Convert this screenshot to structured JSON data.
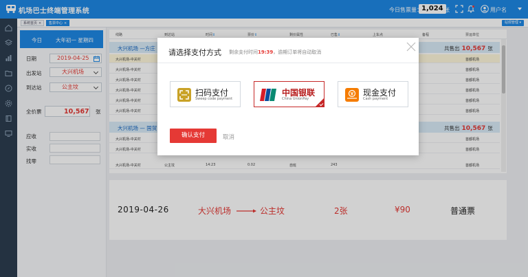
{
  "header": {
    "title": "机场巴士终端管理系统",
    "ticket_label": "今日售票量：",
    "ticket_count": "1,024",
    "ticket_unit": "张",
    "user_name": "用户名",
    "brand_color": "#1e88e5"
  },
  "tabs": [
    {
      "label": "系统首页",
      "active": false
    },
    {
      "label": "售票中心",
      "active": true
    }
  ],
  "site_button": "站现管理",
  "side": {
    "today": "今日",
    "lunar": "大年初一  星期四",
    "date_label": "日期",
    "date_value": "2019-04-25",
    "from_label": "出发站",
    "from_value": "大兴机场",
    "to_label": "到达站",
    "to_value": "公主坟",
    "price_label": "全价票",
    "price_value": "10,567",
    "price_unit": "张",
    "receivable_label": "应收",
    "received_label": "实收",
    "change_label": "找零"
  },
  "table": {
    "headers": [
      "线路",
      "到达站",
      "时间",
      "票价",
      "剩价属性",
      "已售",
      "上车点",
      "备程",
      "票运单位"
    ],
    "groups": [
      {
        "route": "大兴机场 —方庄",
        "sold_label": "共售出",
        "sold_value": "10,567",
        "sold_unit": "张",
        "rows": [
          {
            "line": "大兴机场-中关村",
            "unit": "首都机场",
            "stop": "",
            "time": "",
            "price": "",
            "attr": "",
            "sold": ""
          },
          {
            "line": "大兴机场-中关村",
            "unit": "首都机场",
            "stop": "",
            "time": "",
            "price": "",
            "attr": "",
            "sold": ""
          },
          {
            "line": "大兴机场-中关村",
            "unit": "首都机场",
            "stop": "",
            "time": "",
            "price": "",
            "attr": "",
            "sold": ""
          },
          {
            "line": "大兴机场-中关村",
            "unit": "首都机场",
            "stop": "",
            "time": "",
            "price": "",
            "attr": "",
            "sold": ""
          },
          {
            "line": "大兴机场-中关村",
            "unit": "首都机场",
            "stop": "",
            "time": "",
            "price": "",
            "attr": "",
            "sold": ""
          },
          {
            "line": "大兴机场-中关村",
            "unit": "首都机场",
            "stop": "",
            "time": "",
            "price": "",
            "attr": "",
            "sold": ""
          }
        ]
      },
      {
        "route": "大兴机场 — 国贸",
        "sold_label": "共售出",
        "sold_value": "10,567",
        "sold_unit": "张",
        "rows": [
          {
            "line": "大兴机场-中关村",
            "unit": "首都机场",
            "stop": "",
            "time": "",
            "price": "",
            "attr": "",
            "sold": ""
          },
          {
            "line": "大兴机场-中关村",
            "unit": "首都机场",
            "stop": "",
            "time": "",
            "price": "",
            "attr": "",
            "sold": ""
          },
          {
            "line": "大兴机场-中关村",
            "unit": "首都机场",
            "stop": "公主坟",
            "time": "14:23",
            "price": "0.02",
            "attr": "自班",
            "sold": "243"
          }
        ]
      }
    ]
  },
  "summary": {
    "date": "2019-04-26",
    "from": "大兴机场",
    "to": "公主坟",
    "count": "2张",
    "price": "¥90",
    "type": "普通票"
  },
  "modal": {
    "title": "请选择支付方式",
    "sub_prefix": "剩余支付时间",
    "countdown": "19:39",
    "sub_suffix": "，逾期订单将自动取消",
    "options": [
      {
        "name": "扫码支付",
        "sub": "Sweep code payment",
        "icon": "qr-scan-icon",
        "selected": false
      },
      {
        "name": "中国银联",
        "sub": "China UnionPay",
        "icon": "unionpay-icon",
        "selected": true
      },
      {
        "name": "现金支付",
        "sub": "Cash payment",
        "icon": "cash-icon",
        "selected": false
      }
    ],
    "confirm": "确认支付",
    "cancel": "取消"
  }
}
